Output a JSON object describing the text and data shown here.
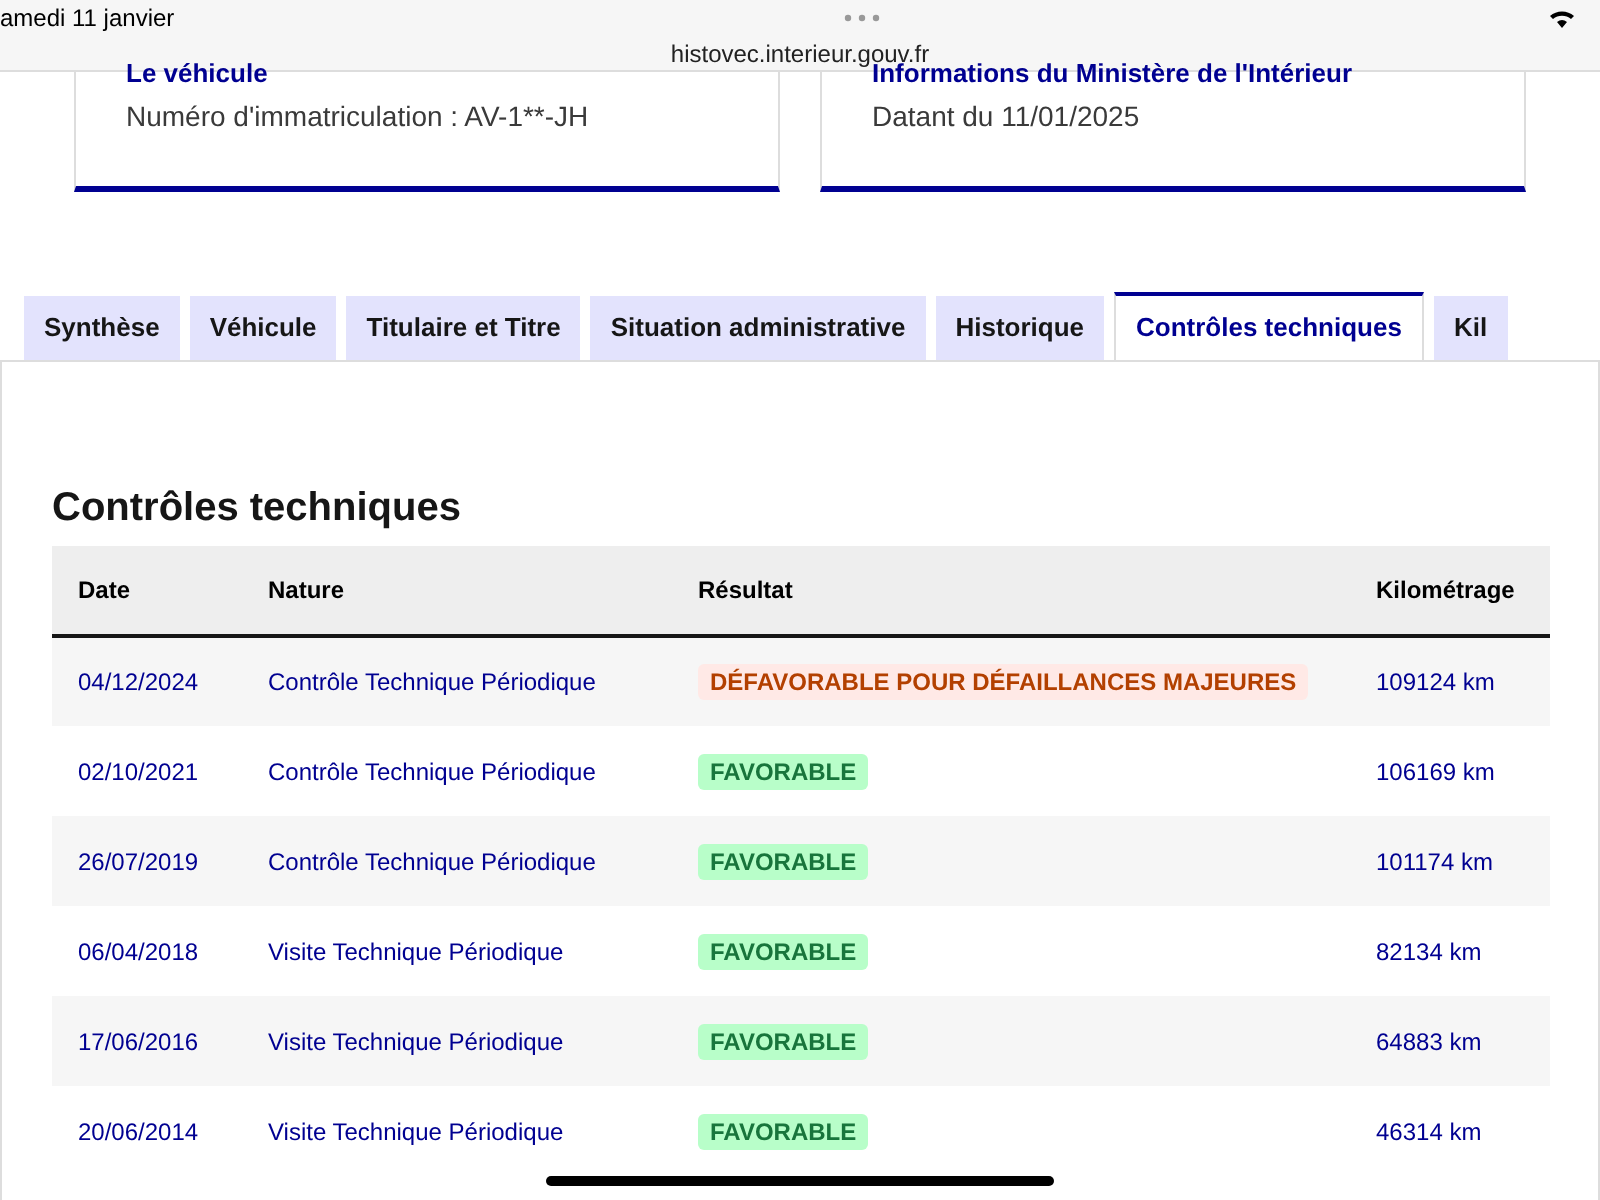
{
  "status_bar": {
    "date": "amedi 11 janvier"
  },
  "address_bar": {
    "url": "histovec.interieur.gouv.fr"
  },
  "cards": [
    {
      "title": "Le véhicule",
      "text": "Numéro d'immatriculation : AV-1**-JH"
    },
    {
      "title": "Informations du Ministère de l'Intérieur",
      "text": "Datant du 11/01/2025"
    }
  ],
  "tabs": [
    {
      "label": "Synthèse",
      "selected": false
    },
    {
      "label": "Véhicule",
      "selected": false
    },
    {
      "label": "Titulaire et Titre",
      "selected": false
    },
    {
      "label": "Situation administrative",
      "selected": false
    },
    {
      "label": "Historique",
      "selected": false
    },
    {
      "label": "Contrôles techniques",
      "selected": true
    },
    {
      "label": "Kil",
      "selected": false
    }
  ],
  "section": {
    "title": "Contrôles techniques"
  },
  "table": {
    "columns": [
      "Date",
      "Nature",
      "Résultat",
      "Kilométrage"
    ],
    "rows": [
      {
        "date": "04/12/2024",
        "nature": "Contrôle Technique Périodique",
        "result": {
          "kind": "unfavorable",
          "label": "DÉFAVORABLE POUR DÉFAILLANCES MAJEURES"
        },
        "km": "109124 km"
      },
      {
        "date": "02/10/2021",
        "nature": "Contrôle Technique Périodique",
        "result": {
          "kind": "favorable",
          "label": "FAVORABLE"
        },
        "km": "106169 km"
      },
      {
        "date": "26/07/2019",
        "nature": "Contrôle Technique Périodique",
        "result": {
          "kind": "favorable",
          "label": "FAVORABLE"
        },
        "km": "101174 km"
      },
      {
        "date": "06/04/2018",
        "nature": "Visite Technique Périodique",
        "result": {
          "kind": "favorable",
          "label": "FAVORABLE"
        },
        "km": "82134 km"
      },
      {
        "date": "17/06/2016",
        "nature": "Visite Technique Périodique",
        "result": {
          "kind": "favorable",
          "label": "FAVORABLE"
        },
        "km": "64883 km"
      },
      {
        "date": "20/06/2014",
        "nature": "Visite Technique Périodique",
        "result": {
          "kind": "favorable",
          "label": "FAVORABLE"
        },
        "km": "46314 km"
      }
    ]
  }
}
